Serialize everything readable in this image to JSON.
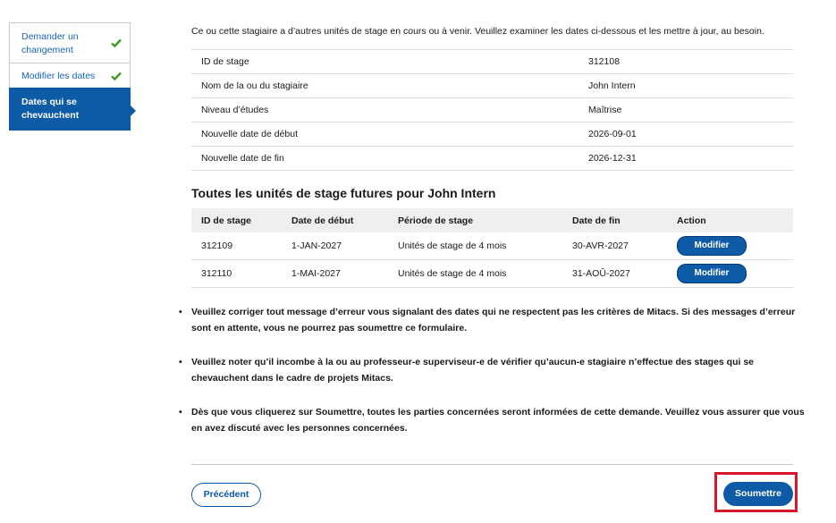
{
  "sidebar": {
    "items": [
      {
        "label": "Demander un changement",
        "completed": true,
        "icon": "check-icon"
      },
      {
        "label": "Modifier les dates",
        "completed": true,
        "icon": "check-icon"
      },
      {
        "label": "Dates qui se chevauchent",
        "active": true
      }
    ]
  },
  "intro": "Ce ou cette stagiaire a d’autres unités de stage en cours ou à venir. Veuillez examiner les dates ci-dessous et les mettre à jour, au besoin.",
  "info": [
    {
      "label": "ID de stage",
      "value": "312108"
    },
    {
      "label": "Nom de la ou du stagiaire",
      "value": "John Intern"
    },
    {
      "label": "Niveau d’études",
      "value": "Maîtrise"
    },
    {
      "label": "Nouvelle date de début",
      "value": "2026-09-01"
    },
    {
      "label": "Nouvelle date de fin",
      "value": "2026-12-31"
    }
  ],
  "future": {
    "title": "Toutes les unités de stage futures pour John Intern",
    "headers": [
      "ID de stage",
      "Date de début",
      "Période de stage",
      "Date de fin",
      "Action"
    ],
    "rows": [
      {
        "id": "312109",
        "start": "1-JAN-2027",
        "period": "Unités de stage de 4 mois",
        "end": "30-AVR-2027",
        "action": "Modifier"
      },
      {
        "id": "312110",
        "start": "1-MAI-2027",
        "period": "Unités de stage de 4 mois",
        "end": "31-AOÛ-2027",
        "action": "Modifier"
      }
    ]
  },
  "notes": [
    "Veuillez corriger tout message d’erreur vous signalant des dates qui ne respectent pas les critères de Mitacs. Si des messages d’erreur sont en attente, vous ne pourrez pas soumettre ce formulaire.",
    "Veuillez noter qu’il incombe à la ou au professeur-e superviseur-e de vérifier qu’aucun-e stagiaire n’effectue des stages qui se chevauchent dans le cadre de projets Mitacs.",
    "Dès que vous cliquerez sur Soumettre, toutes les parties concernées seront informées de cette demande. Veuillez vous assurer que vous en avez discuté avec les personnes concernées."
  ],
  "buttons": {
    "previous": "Précédent",
    "submit": "Soumettre"
  },
  "colors": {
    "primary": "#0d5aa7",
    "check": "#3a9b1e",
    "highlight": "#d7182a"
  }
}
